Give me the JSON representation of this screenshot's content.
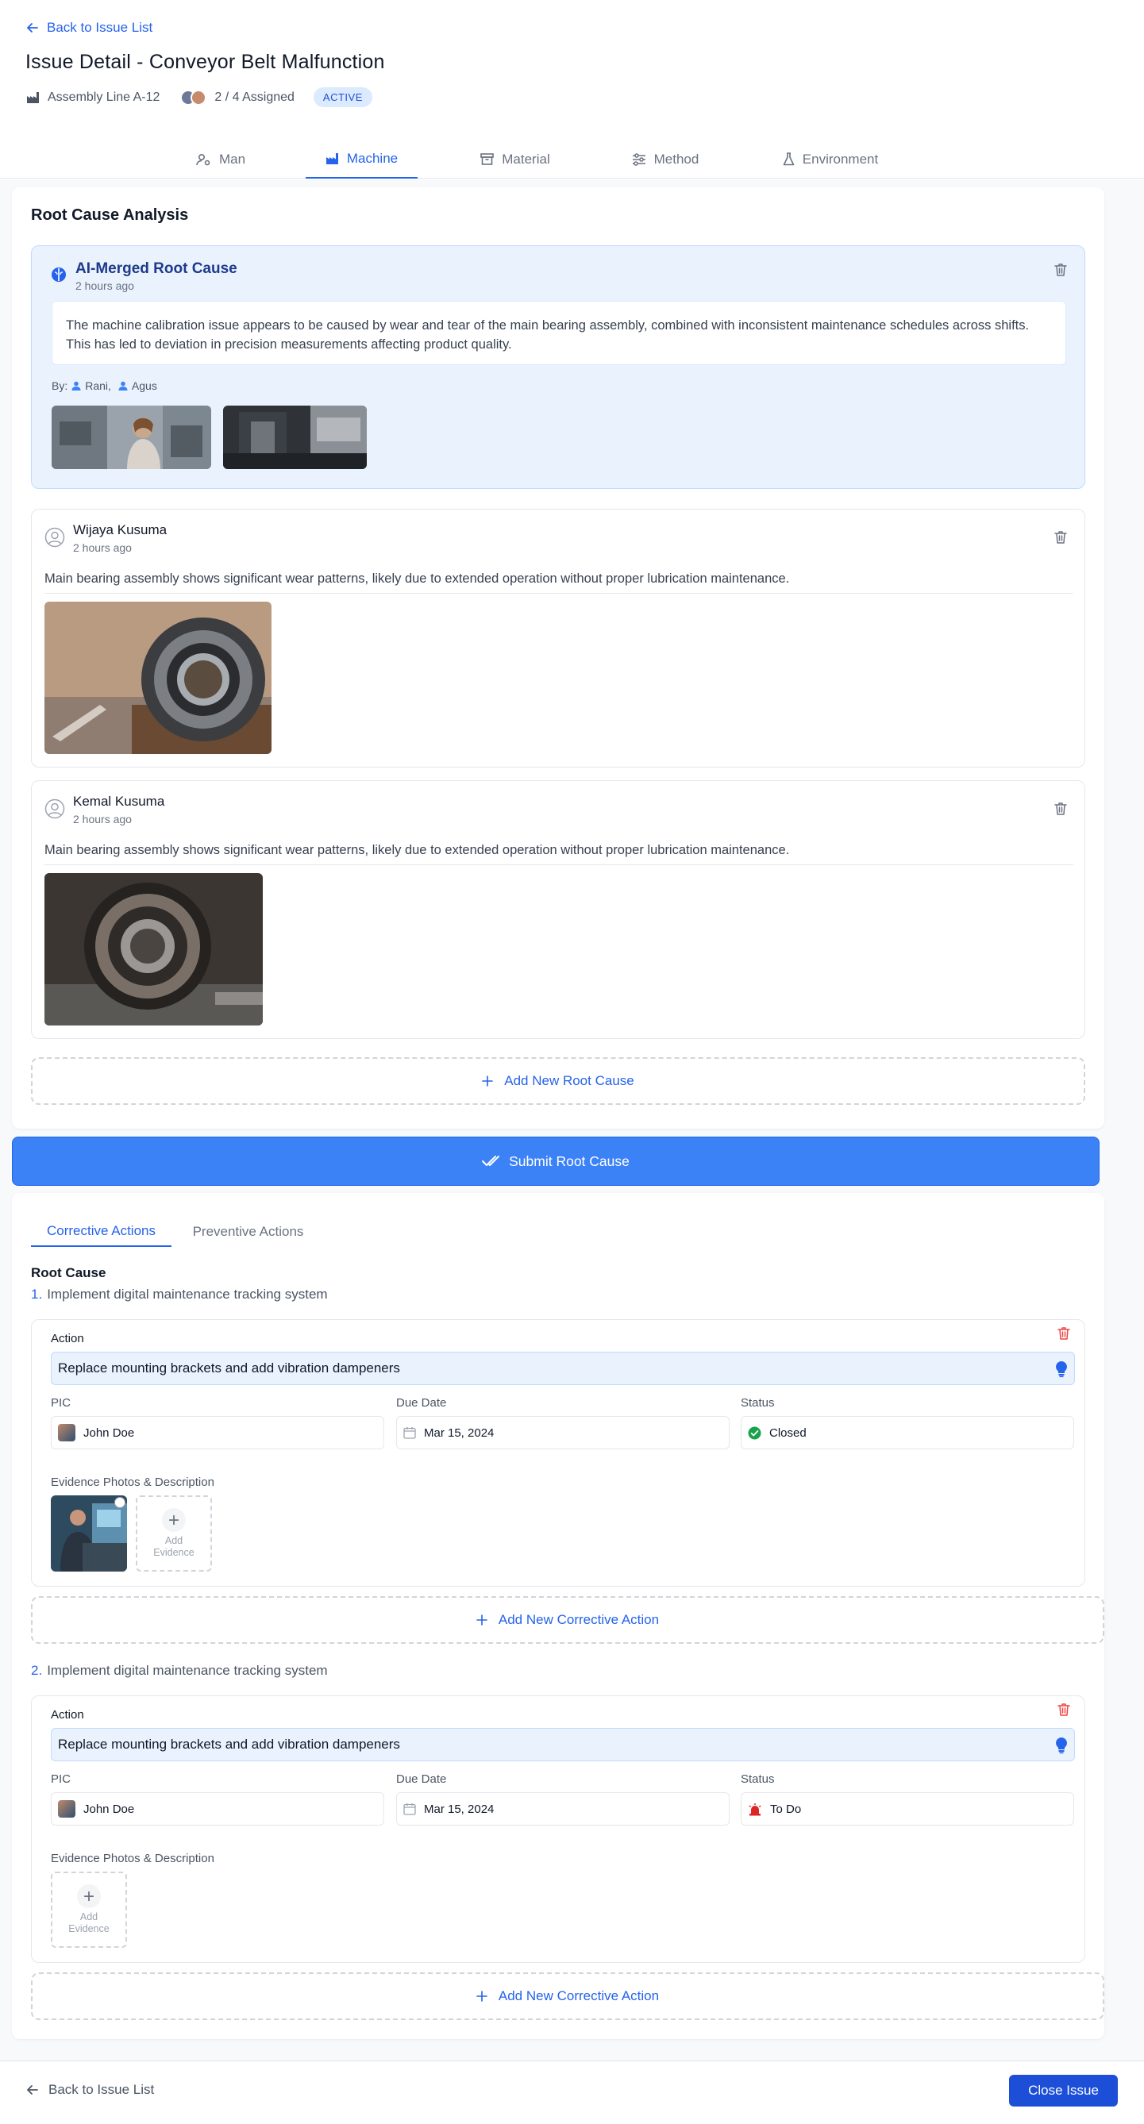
{
  "header": {
    "back_label": "Back to Issue List",
    "title": "Issue Detail - Conveyor Belt Malfunction",
    "location": "Assembly Line A-12",
    "assigned": "2 / 4 Assigned",
    "status_badge": "ACTIVE"
  },
  "tabs": [
    {
      "label": "Man",
      "icon": "user-cog-icon"
    },
    {
      "label": "Machine",
      "icon": "factory-icon",
      "active": true
    },
    {
      "label": "Material",
      "icon": "archive-icon"
    },
    {
      "label": "Method",
      "icon": "sliders-icon"
    },
    {
      "label": "Environment",
      "icon": "flask-icon"
    }
  ],
  "root_cause_analysis": {
    "title": "Root Cause Analysis",
    "ai_merged": {
      "title": "AI-Merged Root Cause",
      "time": "2 hours ago",
      "text": "The machine calibration issue appears to be caused by wear and tear of the main bearing assembly, combined with inconsistent maintenance schedules across shifts. This has led to deviation in precision measurements affecting product quality.",
      "by_label": "By:",
      "contributors": [
        "Rani,",
        "Agus"
      ]
    },
    "items": [
      {
        "author": "Wijaya Kusuma",
        "time": "2 hours ago",
        "text": "Main bearing assembly shows significant wear patterns, likely due to extended operation without proper lubrication maintenance."
      },
      {
        "author": "Kemal Kusuma",
        "time": "2 hours ago",
        "text": "Main bearing assembly shows significant wear patterns, likely due to extended operation without proper lubrication maintenance."
      }
    ],
    "add_label": "Add New Root Cause"
  },
  "submit_label": "Submit Root Cause",
  "actions": {
    "tabs": [
      "Corrective Actions",
      "Preventive Actions"
    ],
    "root_cause_heading": "Root Cause",
    "groups": [
      {
        "number": "1.",
        "root_cause": "Implement digital maintenance tracking system",
        "action_label": "Action",
        "action_value": "Replace mounting brackets and add vibration dampeners",
        "pic_label": "PIC",
        "pic_value": "John Doe",
        "due_label": "Due Date",
        "due_value": "Mar 15, 2024",
        "status_label": "Status",
        "status_value": "Closed",
        "status_color": "#16a34a",
        "evidence_label": "Evidence Photos & Description",
        "add_evidence": "Add Evidence",
        "add_action_label": "Add New Corrective Action"
      },
      {
        "number": "2.",
        "root_cause": "Implement digital maintenance tracking system",
        "action_label": "Action",
        "action_value": "Replace mounting brackets and add vibration dampeners",
        "pic_label": "PIC",
        "pic_value": "John Doe",
        "due_label": "Due Date",
        "due_value": "Mar 15, 2024",
        "status_label": "Status",
        "status_value": "To Do",
        "status_color": "#dc2626",
        "evidence_label": "Evidence Photos & Description",
        "add_evidence": "Add Evidence",
        "add_action_label": "Add New Corrective Action"
      }
    ]
  },
  "footer": {
    "back_label": "Back to Issue List",
    "close_label": "Close Issue"
  },
  "colors": {
    "accent": "#2563eb",
    "submit": "#3b82f6",
    "close": "#1d4ed8",
    "ai_box": "#eaf2fe",
    "danger": "#ef4444",
    "success": "#16a34a"
  }
}
